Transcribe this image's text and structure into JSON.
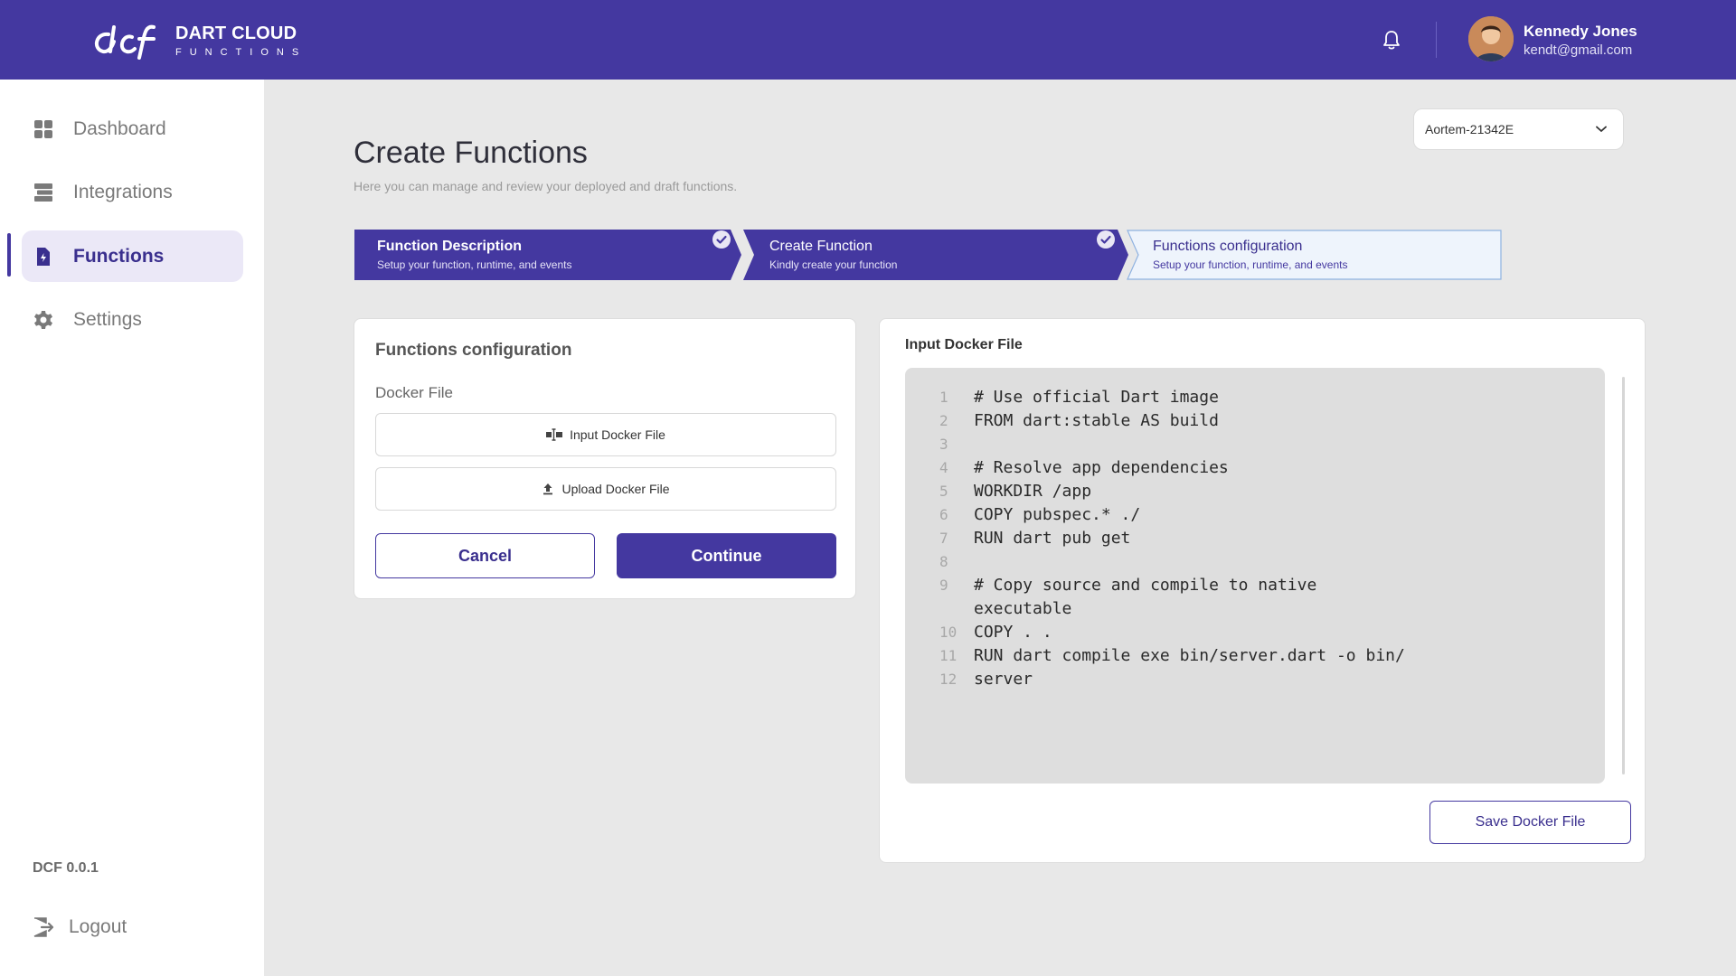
{
  "brand": {
    "title": "DART CLOUD",
    "subtitle": "FUNCTIONS",
    "accent": "#4438a0"
  },
  "user": {
    "name": "Kennedy Jones",
    "email": "kendt@gmail.com"
  },
  "sidebar": {
    "items": [
      {
        "label": "Dashboard",
        "icon": "grid-icon"
      },
      {
        "label": "Integrations",
        "icon": "integrations-icon"
      },
      {
        "label": "Functions",
        "icon": "file-bolt-icon",
        "active": true
      },
      {
        "label": "Settings",
        "icon": "gear-icon"
      }
    ],
    "version": "DCF 0.0.1",
    "logout": "Logout"
  },
  "page": {
    "title": "Create Functions",
    "subtitle": "Here you can manage and review your deployed and draft functions.",
    "project_select": "Aortem-21342E"
  },
  "steps": [
    {
      "title": "Function Description",
      "desc": "Setup your function, runtime, and events",
      "state": "complete"
    },
    {
      "title": "Create Function",
      "desc": "Kindly create your function",
      "state": "complete"
    },
    {
      "title": "Functions configuration",
      "desc": "Setup your function, runtime, and events",
      "state": "current"
    }
  ],
  "config": {
    "title": "Functions configuration",
    "docker_label": "Docker File",
    "input_btn": "Input Docker File",
    "upload_btn": "Upload Docker File",
    "cancel": "Cancel",
    "continue": "Continue"
  },
  "docker": {
    "title": "Input Docker File",
    "lines": [
      {
        "n": "1",
        "text": "# Use official Dart image"
      },
      {
        "n": "2",
        "text": "FROM dart:stable AS build"
      },
      {
        "n": "3",
        "text": ""
      },
      {
        "n": "4",
        "text": "# Resolve app dependencies"
      },
      {
        "n": "5",
        "text": "WORKDIR /app"
      },
      {
        "n": "6",
        "text": "COPY pubspec.* ./"
      },
      {
        "n": "7",
        "text": "RUN dart pub get"
      },
      {
        "n": "8",
        "text": ""
      },
      {
        "n": "9",
        "text": "# Copy source and compile to native"
      },
      {
        "n": "",
        "text": "executable"
      },
      {
        "n": "10",
        "text": "COPY . ."
      },
      {
        "n": "11",
        "text": "RUN dart compile exe bin/server.dart -o bin/"
      },
      {
        "n": "12",
        "text": "server"
      }
    ],
    "save": "Save Docker File"
  }
}
